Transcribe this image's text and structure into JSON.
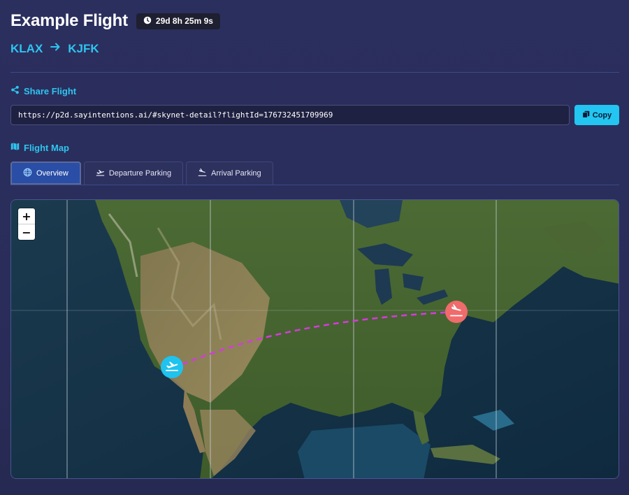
{
  "header": {
    "title": "Example Flight",
    "timer": "29d 8h 25m 9s",
    "timer_icon": "clock-icon"
  },
  "route": {
    "origin": "KLAX",
    "destination": "KJFK",
    "arrow_icon": "arrow-right-icon"
  },
  "share": {
    "title": "Share Flight",
    "icon": "share-icon",
    "url": "https://p2d.sayintentions.ai/#skynet-detail?flightId=176732451709969",
    "copy_label": "Copy",
    "copy_icon": "copy-icon"
  },
  "map_section": {
    "title": "Flight Map",
    "icon": "map-icon",
    "tabs": [
      {
        "label": "Overview",
        "icon": "globe-icon",
        "active": true
      },
      {
        "label": "Departure Parking",
        "icon": "departure-plane-icon",
        "active": false
      },
      {
        "label": "Arrival Parking",
        "icon": "arrival-plane-icon",
        "active": false
      }
    ],
    "zoom_in": "+",
    "zoom_out": "−",
    "departure_marker_icon": "departure-plane-icon",
    "arrival_marker_icon": "arrival-plane-icon"
  },
  "colors": {
    "accent": "#2ec5f0",
    "departure_marker": "#1fc3ee",
    "arrival_marker": "#f06b6b",
    "route_line": "#d63adf",
    "active_tab": "#2a4ea6"
  }
}
